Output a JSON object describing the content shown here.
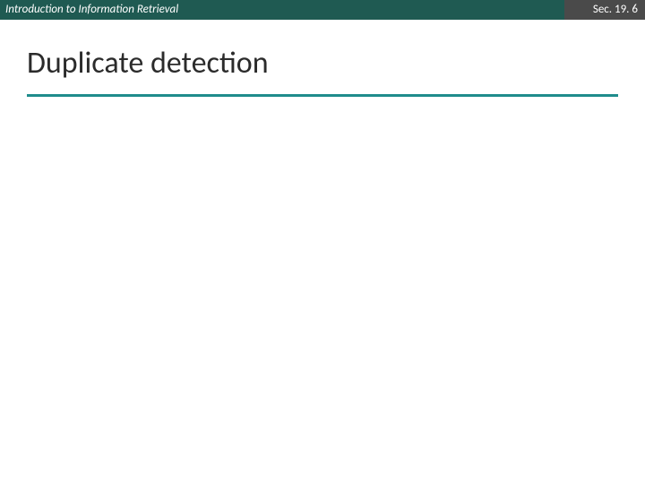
{
  "header": {
    "left": "Introduction to Information Retrieval",
    "right": "Sec. 19. 6"
  },
  "slide": {
    "title": "Duplicate detection"
  },
  "colors": {
    "header_left_bg": "#1f5a52",
    "header_right_bg": "#4a4a4a",
    "title_underline": "#1f8c8c"
  }
}
